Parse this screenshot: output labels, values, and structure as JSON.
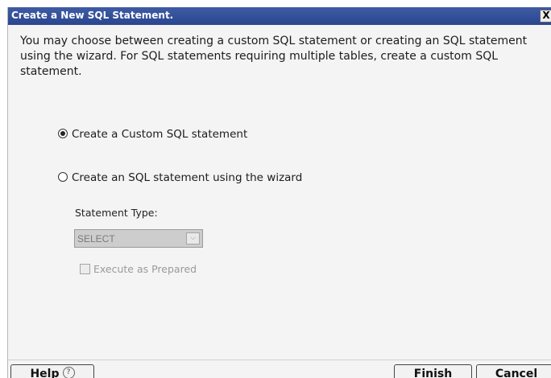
{
  "dialog": {
    "title": "Create a New SQL Statement.",
    "close_glyph": "X",
    "description": "You may choose between creating a custom SQL statement or creating an SQL statement using the wizard. For SQL statements requiring multiple tables, create a custom SQL statement."
  },
  "options": {
    "custom": {
      "label": "Create a Custom SQL statement",
      "selected": true
    },
    "wizard": {
      "label": "Create an SQL statement using the wizard",
      "selected": false
    }
  },
  "statement_type": {
    "label": "Statement Type:",
    "value": "SELECT",
    "enabled": false
  },
  "execute_prepared": {
    "label": "Execute as Prepared",
    "checked": false,
    "enabled": false
  },
  "buttons": {
    "help": "Help",
    "help_icon_glyph": "?",
    "finish": "Finish",
    "cancel": "Cancel"
  },
  "colors": {
    "titlebar": "#2f4b95",
    "dialog_bg": "#f4f4f4",
    "disabled_text": "#9a9a9a"
  }
}
